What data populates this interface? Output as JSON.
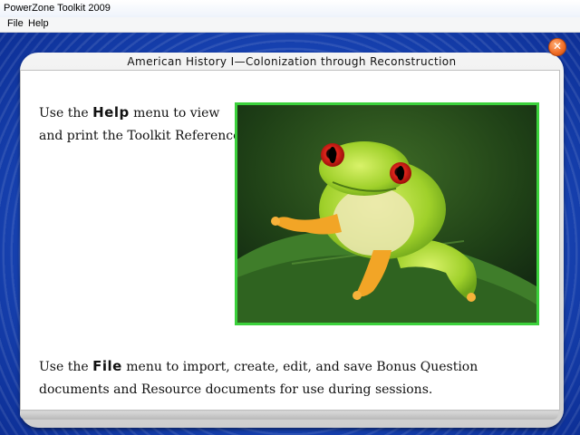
{
  "window": {
    "title": "PowerZone Toolkit 2009"
  },
  "menu": {
    "items": [
      "File",
      "Help"
    ]
  },
  "panel": {
    "heading": "American History I—Colonization through Reconstruction",
    "close_glyph": "✕",
    "help": {
      "prefix": "Use the ",
      "keyword": "Help",
      "suffix_line1": " menu to view",
      "line2": "and print the Toolkit Reference."
    },
    "file": {
      "prefix": "Use the ",
      "keyword": "File",
      "suffix": "  menu to import, create, edit, and save Bonus Question documents and Resource documents for use during sessions."
    }
  },
  "image": {
    "subject": "red-eyed tree frog photo",
    "border_color": "#3bd13b"
  },
  "colors": {
    "background_blue": "#1c4cbf",
    "close_orange": "#ef6a22"
  }
}
